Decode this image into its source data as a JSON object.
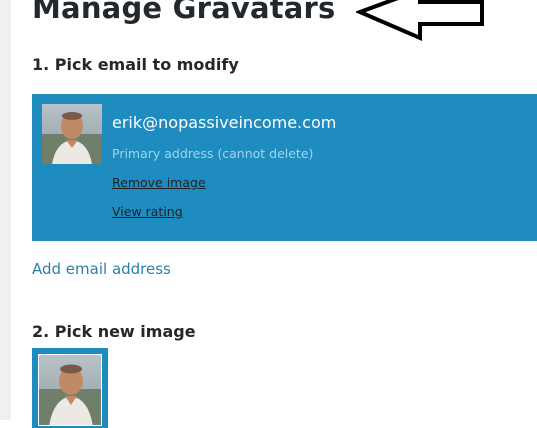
{
  "page": {
    "title": "Manage Gravatars"
  },
  "step1": {
    "heading": "1. Pick email to modify",
    "email": {
      "address": "erik@nopassiveincome.com",
      "note": "Primary address (cannot delete)",
      "remove_label": "Remove image",
      "rating_label": "View rating"
    },
    "add_email_label": "Add email address"
  },
  "step2": {
    "heading": "2. Pick new image"
  },
  "colors": {
    "accent": "#1e8cbe",
    "link": "#2e7fa8",
    "note": "#9fd6ee"
  },
  "icons": {
    "annotation": "arrow-icon",
    "profile_photo": "avatar"
  }
}
